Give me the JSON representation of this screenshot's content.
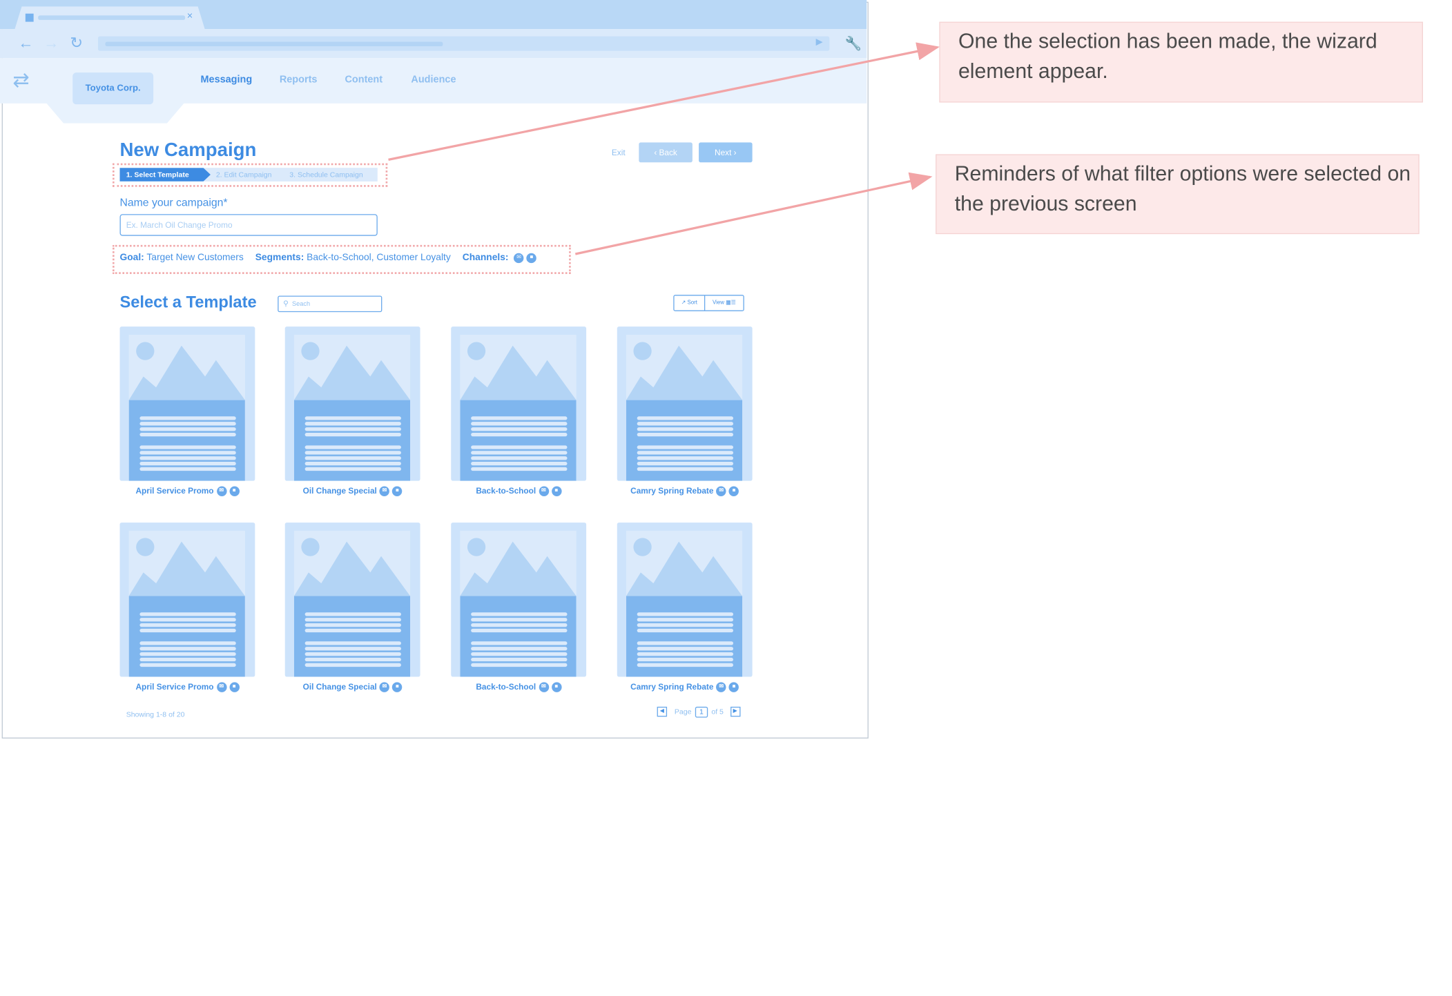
{
  "browser": {
    "nav_icons": [
      "back-arrow-icon",
      "forward-arrow-icon",
      "reload-icon",
      "wrench-icon"
    ],
    "tab_close": "×"
  },
  "app": {
    "account": "Toyota Corp.",
    "nav": [
      "Messaging",
      "Reports",
      "Content",
      "Audience"
    ],
    "active_nav": "Messaging"
  },
  "page": {
    "title": "New Campaign",
    "exit": "Exit",
    "back": "‹  Back",
    "next": "Next  ›",
    "steps": [
      "1. Select Template",
      "2. Edit Campaign",
      "3. Schedule Campaign"
    ],
    "name_label": "Name your campaign*",
    "name_placeholder": "Ex. March Oil Change Promo",
    "summary": {
      "goal_label": "Goal:",
      "goal_value": "Target New Customers",
      "segments_label": "Segments:",
      "segments_value": "Back-to-School, Customer Loyalty",
      "channels_label": "Channels:"
    },
    "templates_title": "Select a Template",
    "search_placeholder": "Seach",
    "sort_label": "Sort",
    "view_label": "View",
    "templates": [
      "April Service Promo",
      "Oil Change Special",
      "Back-to-School",
      "Camry Spring Rebate",
      "April Service Promo",
      "Oil Change Special",
      "Back-to-School",
      "Camry Spring Rebate"
    ],
    "showing": "Showing 1-8 of 20",
    "pager": {
      "page_label": "Page",
      "current": "1",
      "of_label": "of 5"
    }
  },
  "annotations": [
    "One the selection has been made, the wizard element appear.",
    "Reminders of what filter options were selected on the previous screen"
  ],
  "colors": {
    "accent": "#3d8be2",
    "light_blue": "#dbeafb",
    "callout_bg": "#fde9e9",
    "dotted_border": "#f1a8aa"
  }
}
